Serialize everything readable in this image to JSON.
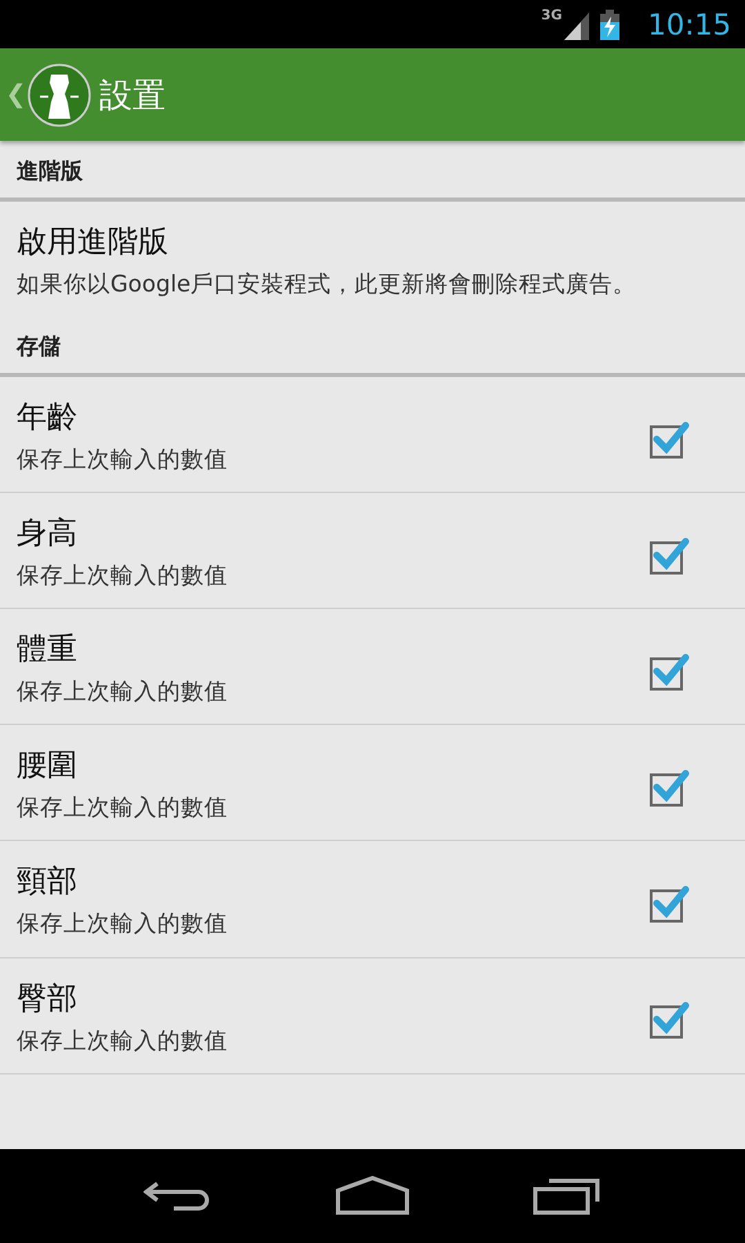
{
  "status_bar": {
    "network": "3G",
    "time": "10:15"
  },
  "action_bar": {
    "back": "❮",
    "title": "設置"
  },
  "sections": [
    {
      "header": "進階版",
      "items": [
        {
          "kind": "plain",
          "title": "啟用進階版",
          "summary": "如果你以Google戶口安裝程式，此更新將會刪除程式廣告。"
        }
      ]
    },
    {
      "header": "存儲",
      "items": [
        {
          "kind": "checkbox",
          "title": "年齡",
          "summary": "保存上次輸入的數值",
          "checked": true
        },
        {
          "kind": "checkbox",
          "title": "身高",
          "summary": "保存上次輸入的數值",
          "checked": true
        },
        {
          "kind": "checkbox",
          "title": "體重",
          "summary": "保存上次輸入的數值",
          "checked": true
        },
        {
          "kind": "checkbox",
          "title": "腰圍",
          "summary": "保存上次輸入的數值",
          "checked": true
        },
        {
          "kind": "checkbox",
          "title": "頸部",
          "summary": "保存上次輸入的數值",
          "checked": true
        },
        {
          "kind": "checkbox",
          "title": "臀部",
          "summary": "保存上次輸入的數值",
          "checked": true
        }
      ]
    }
  ]
}
